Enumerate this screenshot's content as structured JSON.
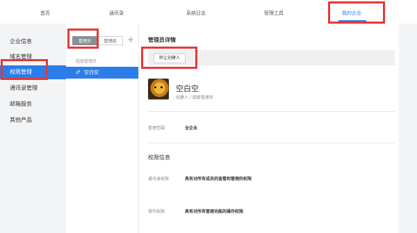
{
  "topnav": {
    "items": [
      {
        "label": "首页"
      },
      {
        "label": "通讯录"
      },
      {
        "label": "系统日志"
      },
      {
        "label": "管理工具"
      },
      {
        "label": "我的企业"
      }
    ],
    "active_index": 4
  },
  "sidebar": {
    "items": [
      {
        "label": "企业信息"
      },
      {
        "label": "域名管理"
      },
      {
        "label": "权限管理"
      },
      {
        "label": "通讯录管理"
      },
      {
        "label": "邮箱服务"
      },
      {
        "label": "其他产品"
      }
    ],
    "active_index": 2
  },
  "list_panel": {
    "tab_admins": "管理员",
    "tab_groups": "管理组",
    "add_icon": "plus-icon",
    "group_label": "超级管理员",
    "selected_member": "空白空"
  },
  "detail": {
    "title": "管理员详情",
    "transfer_button": "转让创建人",
    "name": "空白空",
    "role": "创建人 / 超级管理员",
    "scope_label": "管理范围",
    "scope_value": "全企业",
    "permissions_title": "权限信息",
    "contacts_perm_label": "通讯录权限",
    "contacts_perm_value": "具有对所有成员的查看和管理的权限",
    "ops_perm_label": "操作权限",
    "ops_perm_value": "具有对所有管理功能的操作权限"
  },
  "colors": {
    "accent": "#2b7de9",
    "highlight": "#e53935"
  }
}
